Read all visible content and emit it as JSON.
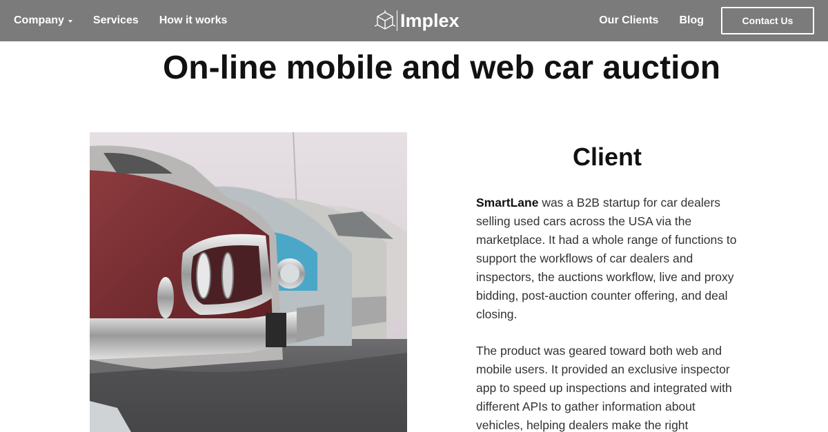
{
  "header": {
    "nav_left": [
      {
        "label": "Company",
        "has_dropdown": true,
        "icon": "caret-down-icon"
      },
      {
        "label": "Services"
      },
      {
        "label": "How it works"
      }
    ],
    "logo": {
      "text": "Implex",
      "icon": "cube-logo-icon"
    },
    "nav_right": [
      {
        "label": "Our Clients"
      },
      {
        "label": "Blog"
      }
    ],
    "contact_button": "Contact Us",
    "background_color": "#7b7b7b"
  },
  "page": {
    "title": "On-line mobile and web car auction"
  },
  "image": {
    "description_icon": "vintage-cars-photo"
  },
  "client_section": {
    "heading": "Client",
    "paragraph1": {
      "strong": "SmartLane",
      "text": " was a B2B startup for car dealers selling used cars across the USA via the marketplace. It had a whole range of functions to support the workflows of car dealers and inspectors, the auctions workflow, live and proxy bidding, post-auction counter offering, and deal closing."
    },
    "paragraph2": "The product was geared toward both web and mobile users. It provided an exclusive inspector app to speed up inspections and integrated with different APIs to gather information about vehicles, helping dealers make the right"
  }
}
